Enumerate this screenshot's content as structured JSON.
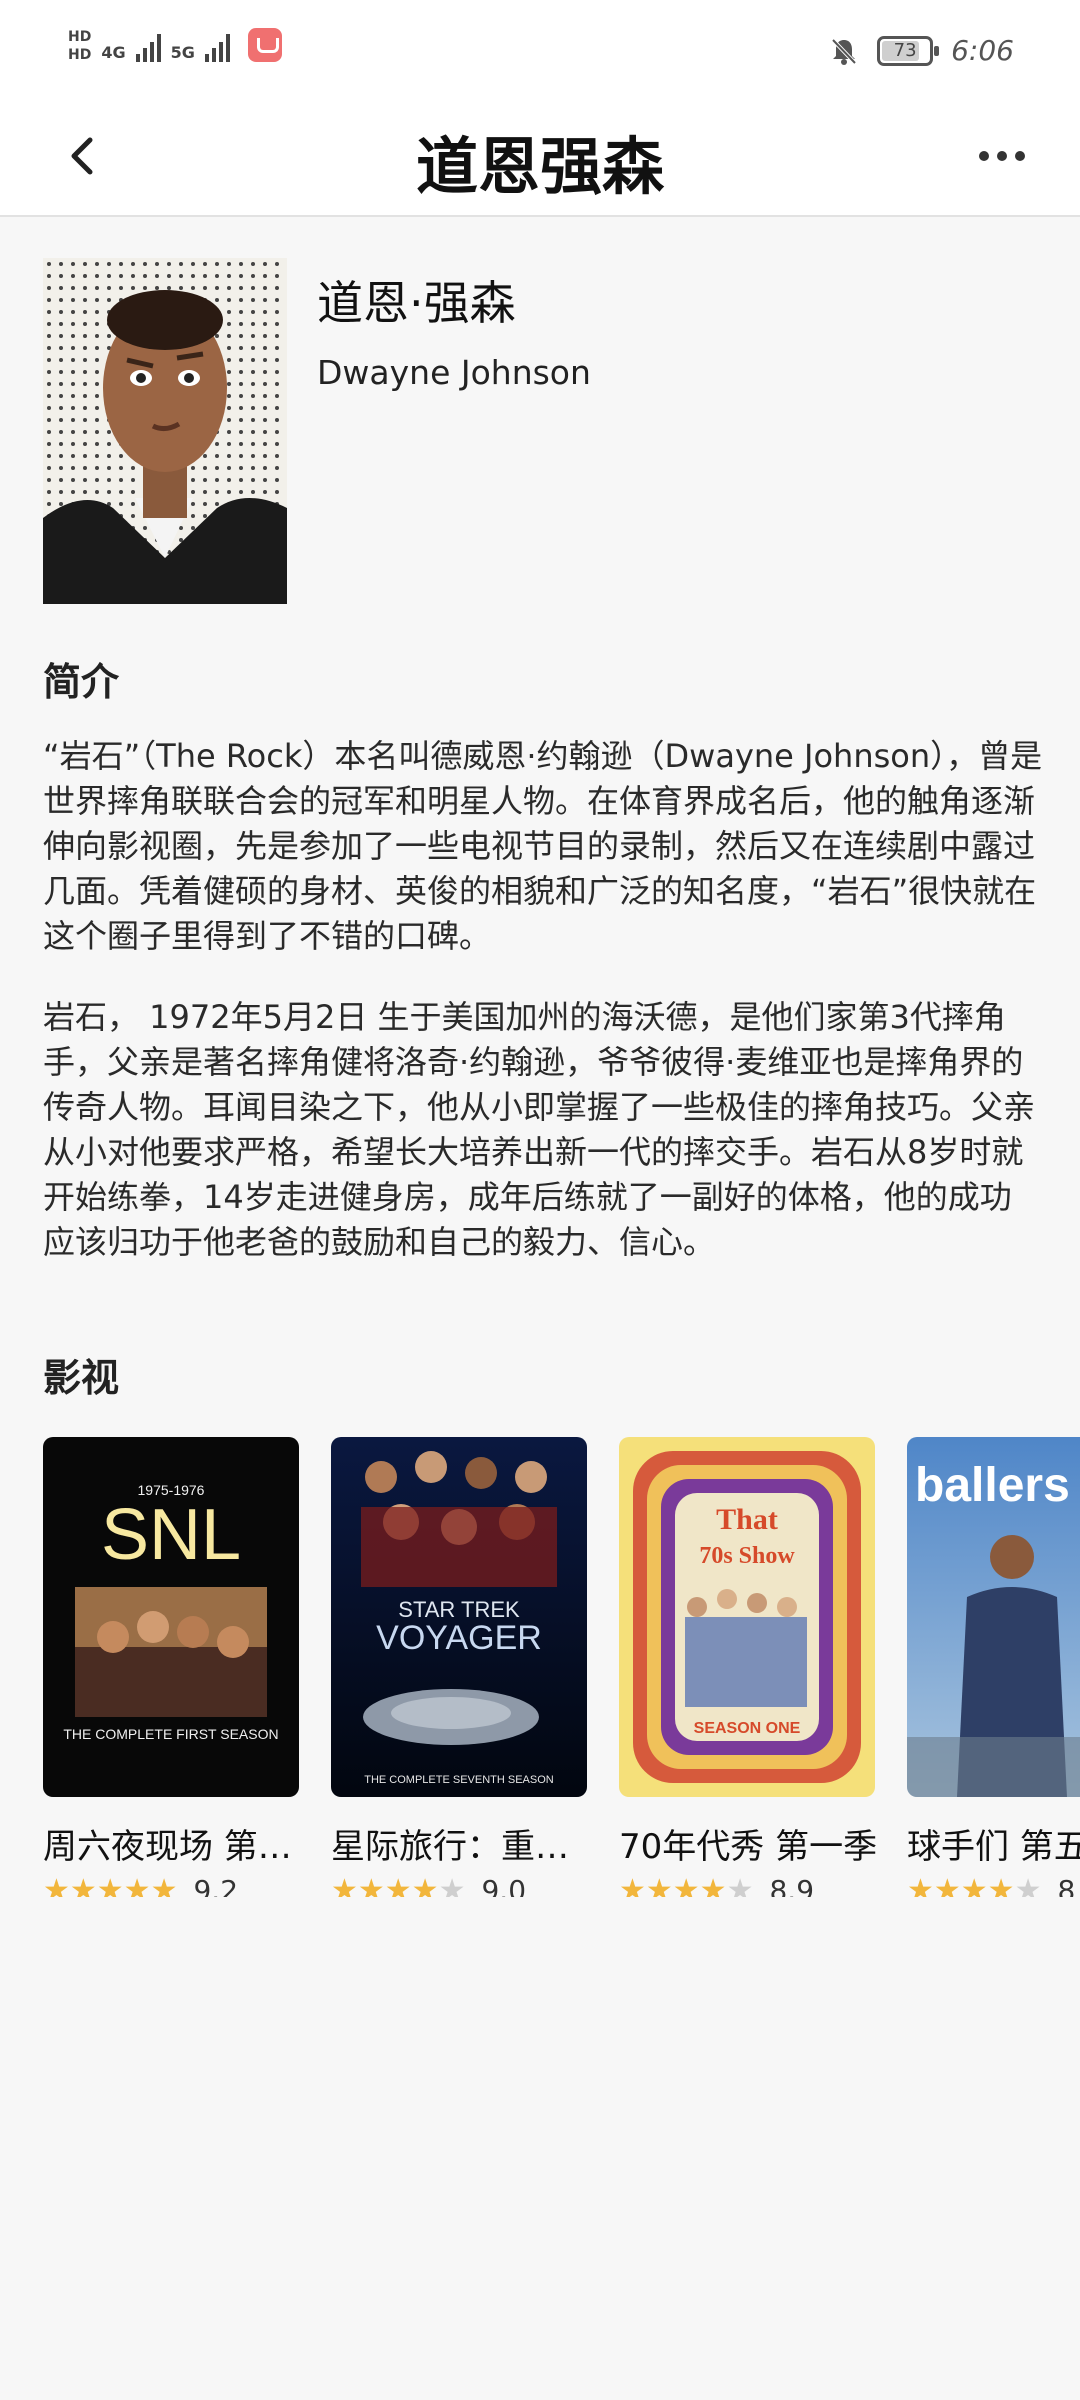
{
  "status_bar": {
    "network_1": "4G",
    "network_2": "5G",
    "battery": "73",
    "time": "6:06",
    "icons": [
      "hd-icon",
      "signal-icon",
      "app-badge-icon",
      "bell-off-icon",
      "battery-icon"
    ]
  },
  "nav": {
    "title": "道恩强森",
    "back_icon": "chevron-left-icon",
    "more_icon": "more-dots-icon"
  },
  "person": {
    "name_cn": "道恩·强森",
    "name_en": "Dwayne Johnson"
  },
  "sections": {
    "intro_title": "简介",
    "films_title": "影视"
  },
  "intro": {
    "paragraph_1": "“岩石”（The Rock）本名叫德威恩·约翰逊（Dwayne Johnson），曾是世界摔角联联合会的冠军和明星人物。在体育界成名后，他的触角逐渐伸向影视圈，先是参加了一些电视节目的录制，然后又在连续剧中露过几面。凭着健硕的身材、英俊的相貌和广泛的知名度，“岩石”很快就在这个圈子里得到了不错的口碑。",
    "paragraph_2": "岩石， 1972年5月2日 生于美国加州的海沃德，是他们家第3代摔角手，父亲是著名摔角健将洛奇·约翰逊，爷爷彼得·麦维亚也是摔角界的传奇人物。耳闻目染之下，他从小即掌握了一些极佳的摔角技巧。父亲从小对他要求严格，希望长大培养出新一代的摔交手。岩石从8岁时就开始练拳，14岁走进健身房，成年后练就了一副好的体格，他的成功应该归功于他老爸的鼓励和自己的毅力、信心。"
  },
  "films": [
    {
      "title": "周六夜现场 第…",
      "score": "9.2",
      "stars": 4.5,
      "poster_text_top": "1975-1976",
      "poster_text_main": "SNL",
      "poster_text_bottom": "THE COMPLETE FIRST SEASON"
    },
    {
      "title": "星际旅行：重…",
      "score": "9.0",
      "stars": 4.5,
      "poster_text_top": "STAR TREK",
      "poster_text_main": "VOYAGER",
      "poster_text_bottom": "THE COMPLETE SEVENTH SEASON"
    },
    {
      "title": "70年代秀 第一季",
      "score": "8.9",
      "stars": 4.5,
      "poster_text_top": "That",
      "poster_text_main": "70s Show",
      "poster_text_bottom": "SEASON ONE"
    },
    {
      "title": "球手们 第五",
      "score": "8",
      "stars": 4.5,
      "poster_text_top": "",
      "poster_text_main": "ballers",
      "poster_text_bottom": ""
    }
  ]
}
